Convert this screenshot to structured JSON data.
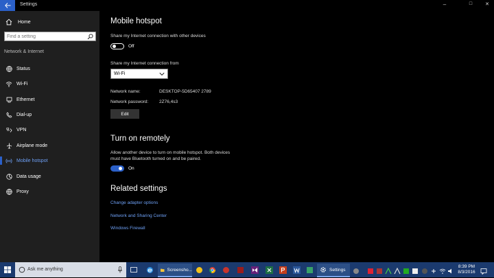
{
  "window": {
    "title": "Settings",
    "minimize": "–",
    "maximize": "□",
    "close": "✕"
  },
  "sidebar": {
    "home": "Home",
    "search_placeholder": "Find a setting",
    "section": "Network & Internet",
    "items": [
      {
        "label": "Status",
        "icon": "globe-icon"
      },
      {
        "label": "Wi-Fi",
        "icon": "wifi-icon"
      },
      {
        "label": "Ethernet",
        "icon": "ethernet-icon"
      },
      {
        "label": "Dial-up",
        "icon": "phone-icon"
      },
      {
        "label": "VPN",
        "icon": "vpn-icon"
      },
      {
        "label": "Airplane mode",
        "icon": "airplane-icon"
      },
      {
        "label": "Mobile hotspot",
        "icon": "hotspot-icon",
        "active": true
      },
      {
        "label": "Data usage",
        "icon": "data-usage-icon"
      },
      {
        "label": "Proxy",
        "icon": "globe-icon"
      }
    ]
  },
  "main": {
    "title": "Mobile hotspot",
    "share_label": "Share my Internet connection with other devices",
    "share_state": "Off",
    "share_from_label": "Share my Internet connection from",
    "share_from_value": "Wi-Fi",
    "network_name_label": "Network name:",
    "network_name_value": "DESKTOP-5D65407 2789",
    "network_password_label": "Network password:",
    "network_password_value": "2Z76,4s3",
    "edit_label": "Edit",
    "remote_title": "Turn on remotely",
    "remote_desc_1": "Allow another device to turn on mobile hotspot. Both devices",
    "remote_desc_2": "must have Bluetooth turned on and be paired.",
    "remote_state": "On",
    "related_title": "Related settings",
    "links": [
      "Change adapter options",
      "Network and Sharing Center",
      "Windows Firewall"
    ]
  },
  "taskbar": {
    "search_placeholder": "Ask me anything",
    "apps": [
      {
        "label": "Screensho...",
        "icon": "explorer-icon"
      },
      {
        "label": "Settings",
        "icon": "gear-icon"
      }
    ],
    "time": "8:39 PM",
    "date": "8/3/2016"
  },
  "colors": {
    "accent": "#2b60c8",
    "link": "#6ea0f5",
    "sidebar_bg": "#1f1f1f",
    "taskbar_bg": "#1b3a6e"
  }
}
